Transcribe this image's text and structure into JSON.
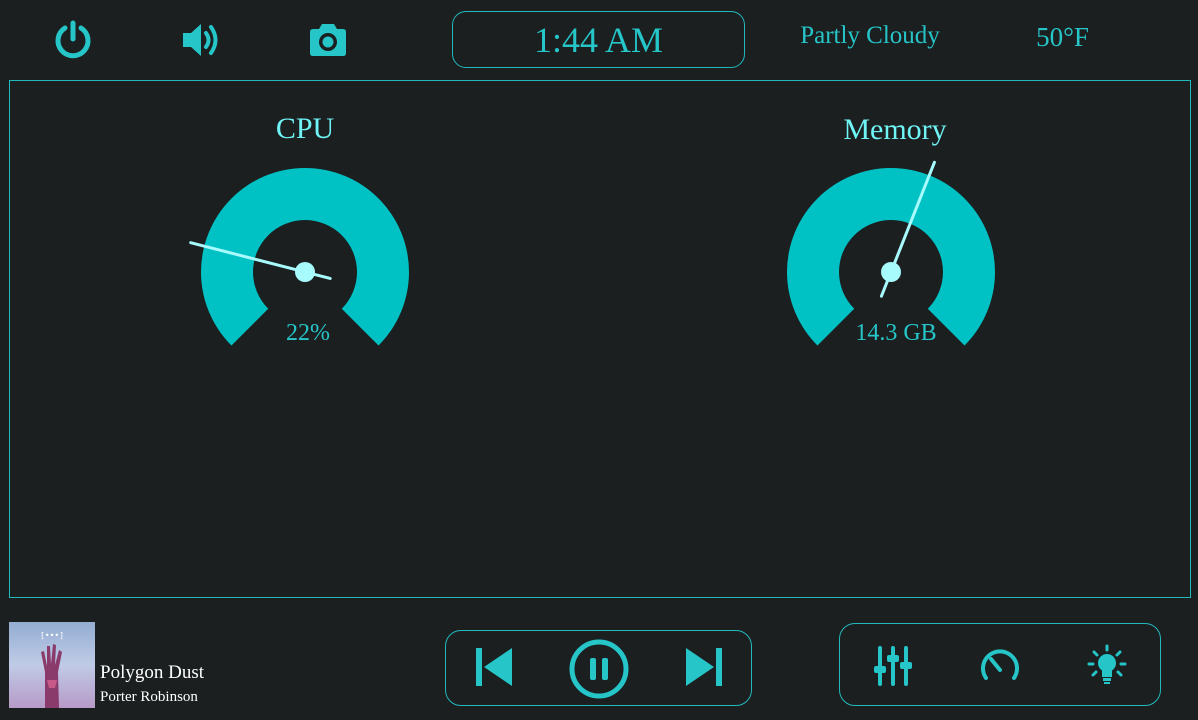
{
  "topbar": {
    "power_icon": "power-icon",
    "volume_icon": "volume-icon",
    "camera_icon": "camera-icon",
    "clock": "1:44 AM",
    "weather_condition": "Partly Cloudy",
    "temperature": "50°F"
  },
  "gauges": {
    "cpu": {
      "title": "CPU",
      "value_text": "22%",
      "level_percent": 22
    },
    "memory": {
      "title": "Memory",
      "value_text": "14.3 GB",
      "level_percent": 58
    }
  },
  "now_playing": {
    "title": "Polygon Dust",
    "artist": "Porter Robinson",
    "album_art_text": "[•••]"
  },
  "media_controls": {
    "previous_icon": "skip-previous-icon",
    "pause_icon": "pause-circle-icon",
    "next_icon": "skip-next-icon"
  },
  "tools": {
    "equalizer_icon": "equalizer-sliders-icon",
    "speedometer_icon": "speedometer-icon",
    "lightbulb_icon": "lightbulb-icon"
  },
  "colors": {
    "accent": "#25c5c8",
    "gauge_fill": "#00c2c4",
    "needle": "#a8fbfd",
    "background": "#1b1f20",
    "text_white": "#ffffff"
  }
}
